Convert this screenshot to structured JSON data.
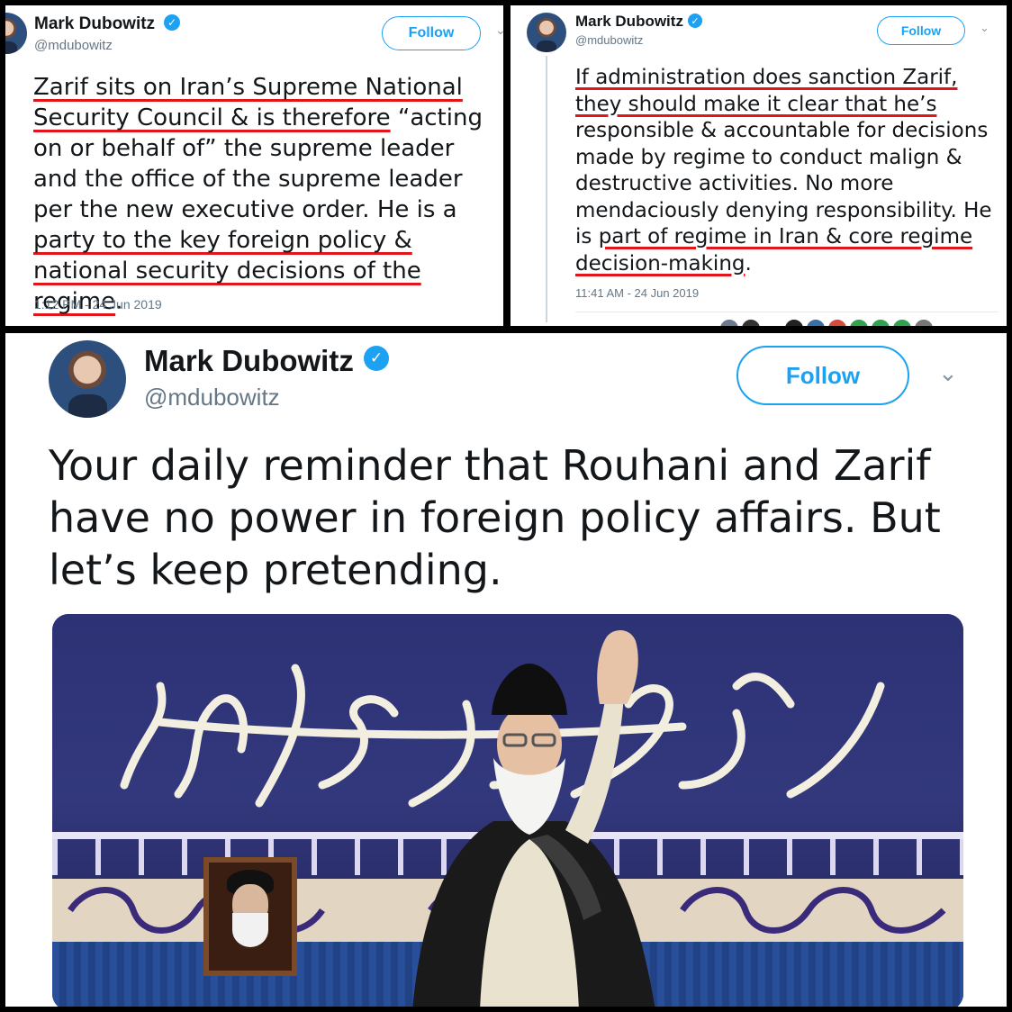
{
  "tweets": [
    {
      "author": "Mark Dubowitz",
      "handle": "@mdubowitz",
      "follow_label": "Follow",
      "segments": [
        {
          "t": "Zarif sits on Iran’s Supreme National Security Council & is therefore",
          "u": true
        },
        {
          "t": " “acting on or behalf of” the supreme leader and the office of the supreme leader per the new executive order. He is a ",
          "u": false
        },
        {
          "t": "party to the key foreign policy & national security decisions of the regime",
          "u": true
        },
        {
          "t": ".",
          "u": false
        }
      ],
      "timestamp": "1:12 PM - 24 Jun 2019"
    },
    {
      "author": "Mark Dubowitz",
      "handle": "@mdubowitz",
      "follow_label": "Follow",
      "segments": [
        {
          "t": "If administration does sanction Zarif, they should make it clear that he’s",
          "u": true
        },
        {
          "t": " responsible & accountable for decisions made by regime to conduct malign & destructive activities. No more mendaciously denying responsibility. He is ",
          "u": false
        },
        {
          "t": "part of regime in Iran & core regime decision-making",
          "u": true
        },
        {
          "t": ".",
          "u": false
        }
      ],
      "timestamp": "11:41 AM - 24 Jun 2019"
    },
    {
      "author": "Mark Dubowitz",
      "handle": "@mdubowitz",
      "follow_label": "Follow",
      "segments": [
        {
          "t": "Your daily reminder that Rouhani and Zarif have no power in foreign policy affairs. But let’s keep pretending.",
          "u": false
        }
      ]
    }
  ],
  "icons": {
    "verified": "verified-badge-icon",
    "chevron": "chevron-down-icon"
  },
  "colors": {
    "accent": "#1da1f2",
    "underline": "#e3151a",
    "text": "#14171a",
    "muted": "#657786"
  },
  "likers_colors": [
    "#6b7a8f",
    "#333333",
    "#ffffff",
    "#222222",
    "#3a6ea5",
    "#d84a3a",
    "#2ea44f",
    "#2ea44f",
    "#2ea44f",
    "#777777"
  ]
}
